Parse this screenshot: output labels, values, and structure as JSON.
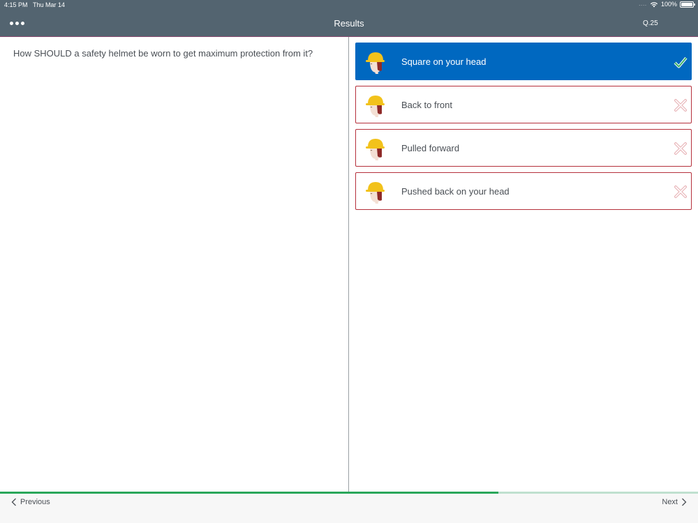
{
  "status": {
    "time": "4:15 PM",
    "date": "Thu Mar 14",
    "signal": "....",
    "battery": "100%"
  },
  "header": {
    "title": "Results",
    "question_number": "Q.25",
    "menu_icon": "more-horizontal-icon"
  },
  "question": {
    "text": "How SHOULD a safety helmet be worn to get maximum protection from it?"
  },
  "answers": [
    {
      "label": "Square on your head",
      "state": "correct",
      "selected": true,
      "icon": "checkmark-icon"
    },
    {
      "label": "Back to front",
      "state": "incorrect",
      "selected": false,
      "icon": "cross-icon"
    },
    {
      "label": "Pulled forward",
      "state": "incorrect",
      "selected": false,
      "icon": "cross-icon"
    },
    {
      "label": "Pushed back on your head",
      "state": "incorrect",
      "selected": false,
      "icon": "cross-icon"
    }
  ],
  "progress": {
    "fraction": 0.714
  },
  "footer": {
    "previous_label": "Previous",
    "next_label": "Next"
  },
  "colors": {
    "header_bg": "#536470",
    "selected_answer": "#0068c0",
    "answer_border": "#b5303b",
    "progress_fill": "#2aa75a",
    "correct_check": "#3db36a",
    "incorrect_cross": "#e8b4b8",
    "helmet_yellow": "#f2c21b"
  }
}
